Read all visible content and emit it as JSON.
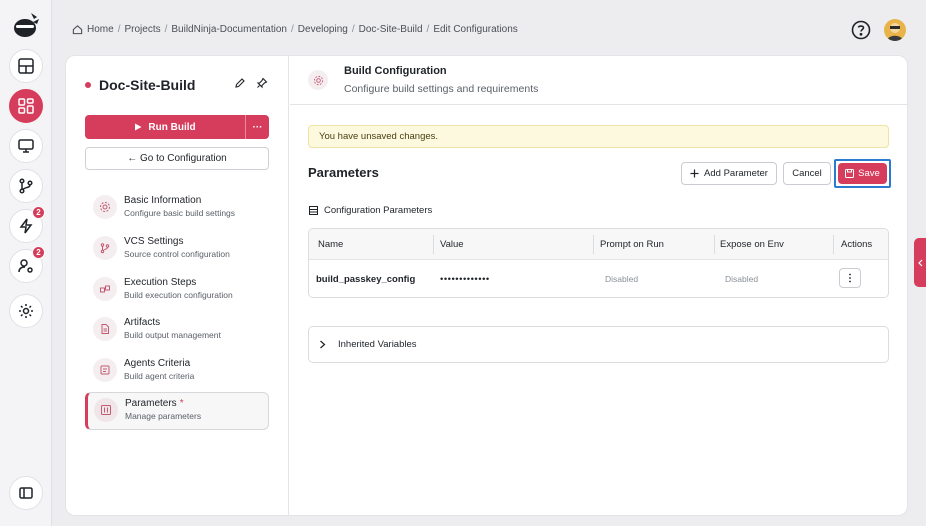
{
  "breadcrumb": {
    "items": [
      "Home",
      "Projects",
      "BuildNinja-Documentation",
      "Developing",
      "Doc-Site-Build",
      "Edit Configurations"
    ],
    "separator": "/"
  },
  "rail": {
    "badges": {
      "lightning": "2",
      "user_settings": "2"
    }
  },
  "sidebar": {
    "title": "Doc-Site-Build",
    "run_label": "Run Build",
    "more_label": "···",
    "goto_label": "← Go to Configuration",
    "items": [
      {
        "title": "Basic Information",
        "subtitle": "Configure basic build settings"
      },
      {
        "title": "VCS Settings",
        "subtitle": "Source control configuration"
      },
      {
        "title": "Execution Steps",
        "subtitle": "Build execution configuration"
      },
      {
        "title": "Artifacts",
        "subtitle": "Build output management"
      },
      {
        "title": "Agents Criteria",
        "subtitle": "Build agent criteria"
      },
      {
        "title": "Parameters",
        "subtitle": "Manage parameters",
        "modified": "*"
      }
    ]
  },
  "content": {
    "header_title": "Build Configuration",
    "header_subtitle": "Configure build settings and requirements",
    "warning": "You have unsaved changes.",
    "section_title": "Parameters",
    "add_label": "Add Parameter",
    "cancel_label": "Cancel",
    "save_label": "Save",
    "config_title": "Configuration Parameters",
    "table": {
      "headers": [
        "Name",
        "Value",
        "Prompt on Run",
        "Expose on Env",
        "Actions"
      ],
      "rows": [
        {
          "name": "build_passkey_config",
          "value": "•••••••••••••",
          "prompt": "Disabled",
          "expose": "Disabled"
        }
      ]
    },
    "inherited_label": "Inherited Variables"
  },
  "colors": {
    "accent": "#d63d5c",
    "focus": "#2b7bd1",
    "warning_bg": "#fdf9df"
  }
}
